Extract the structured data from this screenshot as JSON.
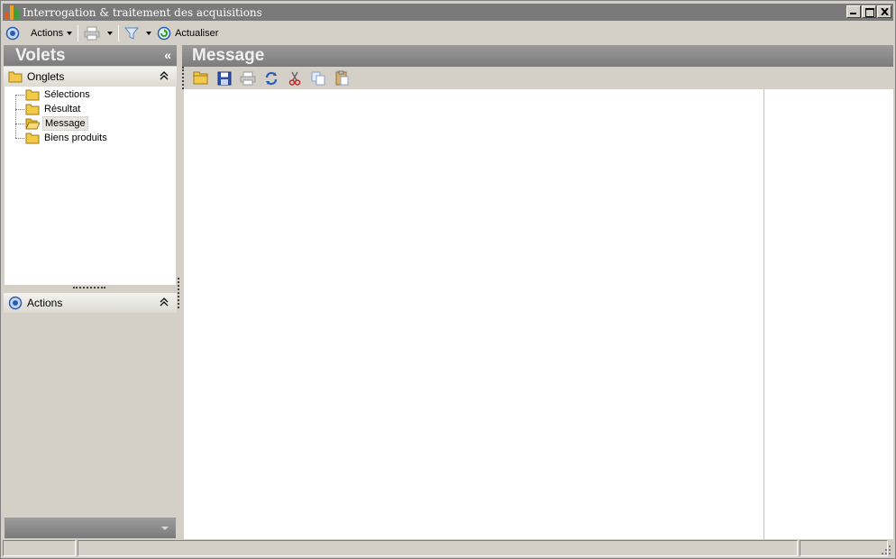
{
  "window": {
    "title": "Interrogation & traitement des acquisitions",
    "title_bar_color": "#7a7a7a",
    "controls": [
      "minimize-icon",
      "maximize-icon",
      "close-icon"
    ]
  },
  "toolbar": {
    "actions_label": "Actions",
    "refresh_label": "Actualiser",
    "icons": [
      "actions-icon",
      "print-icon",
      "filter-icon",
      "refresh-icon"
    ]
  },
  "left_panel": {
    "title": "Volets",
    "collapse_glyph": "«",
    "onglets_group": {
      "label": "Onglets",
      "items": [
        {
          "label": "Sélections",
          "selected": false
        },
        {
          "label": "Résultat",
          "selected": false
        },
        {
          "label": "Message",
          "selected": true
        },
        {
          "label": "Biens produits",
          "selected": false
        }
      ]
    },
    "actions_group": {
      "label": "Actions"
    }
  },
  "main": {
    "title": "Message",
    "toolbar_icons": [
      "open-folder-icon",
      "save-icon",
      "print-icon",
      "refresh-icon",
      "cut-icon",
      "copy-icon",
      "paste-icon"
    ]
  },
  "colors": {
    "face": "#d4d0c8",
    "header_gradient_top": "#9a9a9a",
    "header_gradient_bottom": "#7c7c7c",
    "accent_blue": "#2a5bb5",
    "folder_yellow": "#f2c94c"
  }
}
